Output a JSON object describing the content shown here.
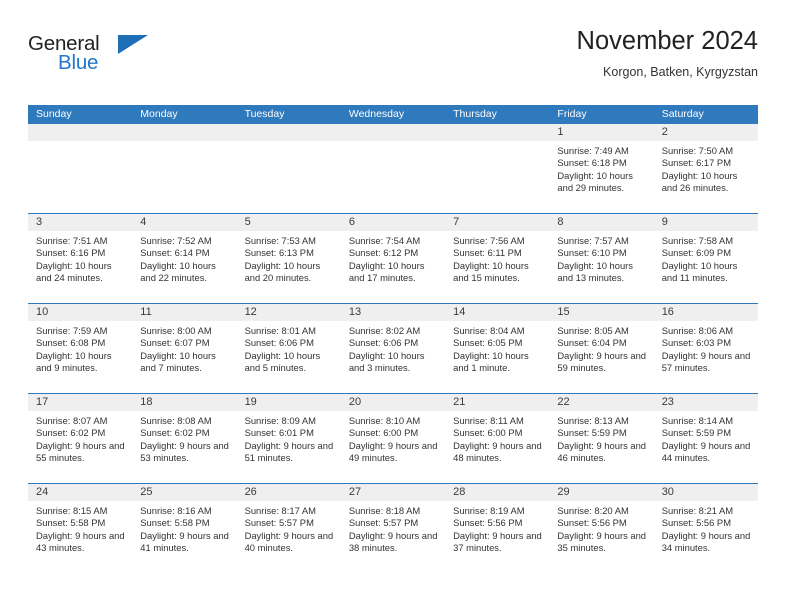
{
  "brand": {
    "name_part1": "General",
    "name_part2": "Blue",
    "triangle_icon": "brand-triangle-icon",
    "accent_color": "#1f6eb8",
    "blue_text_color": "#2277cc"
  },
  "header": {
    "title": "November 2024",
    "location": "Korgon, Batken, Kyrgyzstan"
  },
  "calendar": {
    "header_bg_color": "#2f79bd",
    "day_band_color": "#efefef",
    "weekday_headers": [
      "Sunday",
      "Monday",
      "Tuesday",
      "Wednesday",
      "Thursday",
      "Friday",
      "Saturday"
    ],
    "labels": {
      "sunrise": "Sunrise:",
      "sunset": "Sunset:",
      "daylight": "Daylight:"
    },
    "weeks": [
      [
        {
          "day": "",
          "empty": true
        },
        {
          "day": "",
          "empty": true
        },
        {
          "day": "",
          "empty": true
        },
        {
          "day": "",
          "empty": true
        },
        {
          "day": "",
          "empty": true
        },
        {
          "day": "1",
          "sunrise": "Sunrise: 7:49 AM",
          "sunset": "Sunset: 6:18 PM",
          "daylight": "Daylight: 10 hours and 29 minutes."
        },
        {
          "day": "2",
          "sunrise": "Sunrise: 7:50 AM",
          "sunset": "Sunset: 6:17 PM",
          "daylight": "Daylight: 10 hours and 26 minutes."
        }
      ],
      [
        {
          "day": "3",
          "sunrise": "Sunrise: 7:51 AM",
          "sunset": "Sunset: 6:16 PM",
          "daylight": "Daylight: 10 hours and 24 minutes."
        },
        {
          "day": "4",
          "sunrise": "Sunrise: 7:52 AM",
          "sunset": "Sunset: 6:14 PM",
          "daylight": "Daylight: 10 hours and 22 minutes."
        },
        {
          "day": "5",
          "sunrise": "Sunrise: 7:53 AM",
          "sunset": "Sunset: 6:13 PM",
          "daylight": "Daylight: 10 hours and 20 minutes."
        },
        {
          "day": "6",
          "sunrise": "Sunrise: 7:54 AM",
          "sunset": "Sunset: 6:12 PM",
          "daylight": "Daylight: 10 hours and 17 minutes."
        },
        {
          "day": "7",
          "sunrise": "Sunrise: 7:56 AM",
          "sunset": "Sunset: 6:11 PM",
          "daylight": "Daylight: 10 hours and 15 minutes."
        },
        {
          "day": "8",
          "sunrise": "Sunrise: 7:57 AM",
          "sunset": "Sunset: 6:10 PM",
          "daylight": "Daylight: 10 hours and 13 minutes."
        },
        {
          "day": "9",
          "sunrise": "Sunrise: 7:58 AM",
          "sunset": "Sunset: 6:09 PM",
          "daylight": "Daylight: 10 hours and 11 minutes."
        }
      ],
      [
        {
          "day": "10",
          "sunrise": "Sunrise: 7:59 AM",
          "sunset": "Sunset: 6:08 PM",
          "daylight": "Daylight: 10 hours and 9 minutes."
        },
        {
          "day": "11",
          "sunrise": "Sunrise: 8:00 AM",
          "sunset": "Sunset: 6:07 PM",
          "daylight": "Daylight: 10 hours and 7 minutes."
        },
        {
          "day": "12",
          "sunrise": "Sunrise: 8:01 AM",
          "sunset": "Sunset: 6:06 PM",
          "daylight": "Daylight: 10 hours and 5 minutes."
        },
        {
          "day": "13",
          "sunrise": "Sunrise: 8:02 AM",
          "sunset": "Sunset: 6:06 PM",
          "daylight": "Daylight: 10 hours and 3 minutes."
        },
        {
          "day": "14",
          "sunrise": "Sunrise: 8:04 AM",
          "sunset": "Sunset: 6:05 PM",
          "daylight": "Daylight: 10 hours and 1 minute."
        },
        {
          "day": "15",
          "sunrise": "Sunrise: 8:05 AM",
          "sunset": "Sunset: 6:04 PM",
          "daylight": "Daylight: 9 hours and 59 minutes."
        },
        {
          "day": "16",
          "sunrise": "Sunrise: 8:06 AM",
          "sunset": "Sunset: 6:03 PM",
          "daylight": "Daylight: 9 hours and 57 minutes."
        }
      ],
      [
        {
          "day": "17",
          "sunrise": "Sunrise: 8:07 AM",
          "sunset": "Sunset: 6:02 PM",
          "daylight": "Daylight: 9 hours and 55 minutes."
        },
        {
          "day": "18",
          "sunrise": "Sunrise: 8:08 AM",
          "sunset": "Sunset: 6:02 PM",
          "daylight": "Daylight: 9 hours and 53 minutes."
        },
        {
          "day": "19",
          "sunrise": "Sunrise: 8:09 AM",
          "sunset": "Sunset: 6:01 PM",
          "daylight": "Daylight: 9 hours and 51 minutes."
        },
        {
          "day": "20",
          "sunrise": "Sunrise: 8:10 AM",
          "sunset": "Sunset: 6:00 PM",
          "daylight": "Daylight: 9 hours and 49 minutes."
        },
        {
          "day": "21",
          "sunrise": "Sunrise: 8:11 AM",
          "sunset": "Sunset: 6:00 PM",
          "daylight": "Daylight: 9 hours and 48 minutes."
        },
        {
          "day": "22",
          "sunrise": "Sunrise: 8:13 AM",
          "sunset": "Sunset: 5:59 PM",
          "daylight": "Daylight: 9 hours and 46 minutes."
        },
        {
          "day": "23",
          "sunrise": "Sunrise: 8:14 AM",
          "sunset": "Sunset: 5:59 PM",
          "daylight": "Daylight: 9 hours and 44 minutes."
        }
      ],
      [
        {
          "day": "24",
          "sunrise": "Sunrise: 8:15 AM",
          "sunset": "Sunset: 5:58 PM",
          "daylight": "Daylight: 9 hours and 43 minutes."
        },
        {
          "day": "25",
          "sunrise": "Sunrise: 8:16 AM",
          "sunset": "Sunset: 5:58 PM",
          "daylight": "Daylight: 9 hours and 41 minutes."
        },
        {
          "day": "26",
          "sunrise": "Sunrise: 8:17 AM",
          "sunset": "Sunset: 5:57 PM",
          "daylight": "Daylight: 9 hours and 40 minutes."
        },
        {
          "day": "27",
          "sunrise": "Sunrise: 8:18 AM",
          "sunset": "Sunset: 5:57 PM",
          "daylight": "Daylight: 9 hours and 38 minutes."
        },
        {
          "day": "28",
          "sunrise": "Sunrise: 8:19 AM",
          "sunset": "Sunset: 5:56 PM",
          "daylight": "Daylight: 9 hours and 37 minutes."
        },
        {
          "day": "29",
          "sunrise": "Sunrise: 8:20 AM",
          "sunset": "Sunset: 5:56 PM",
          "daylight": "Daylight: 9 hours and 35 minutes."
        },
        {
          "day": "30",
          "sunrise": "Sunrise: 8:21 AM",
          "sunset": "Sunset: 5:56 PM",
          "daylight": "Daylight: 9 hours and 34 minutes."
        }
      ]
    ]
  }
}
